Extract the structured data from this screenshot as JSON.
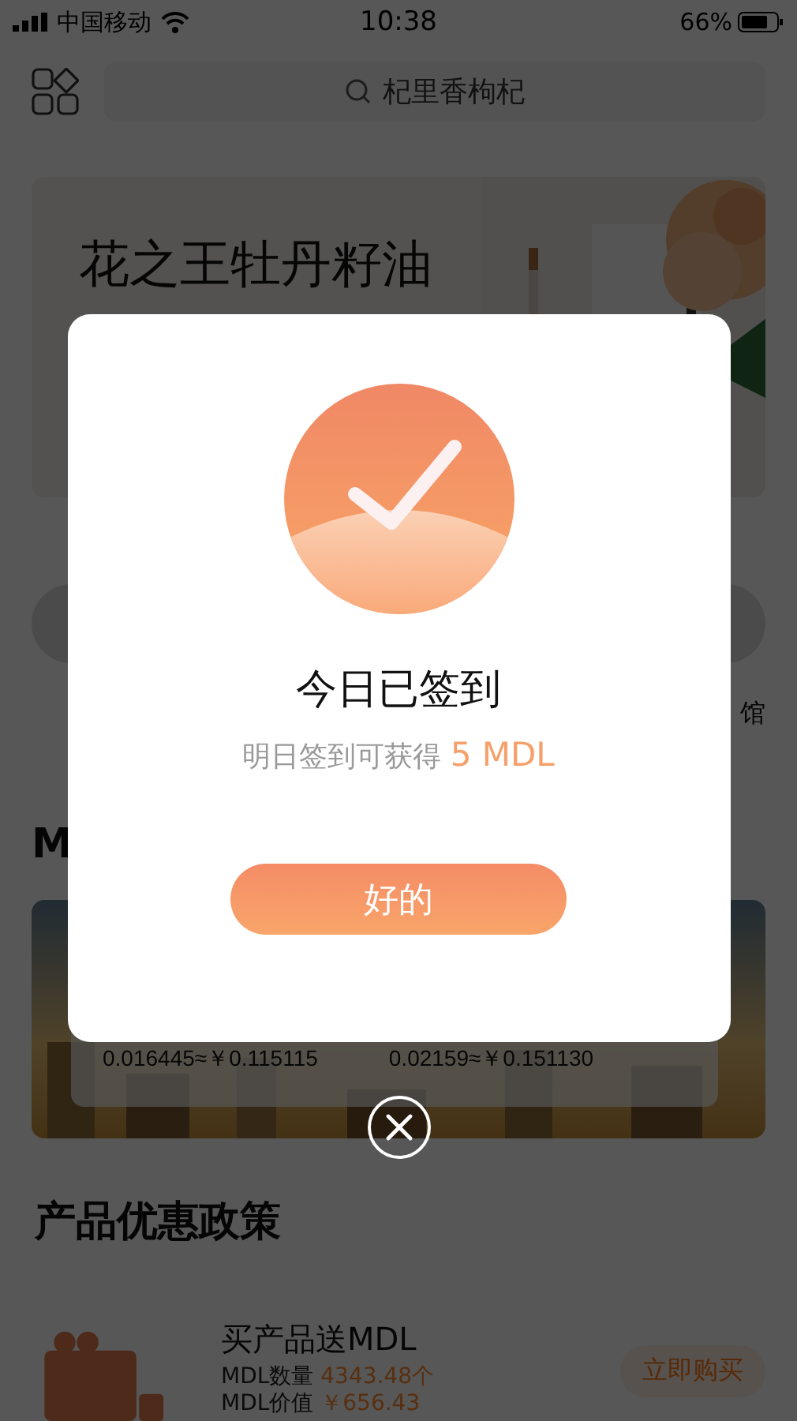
{
  "status_bar": {
    "carrier": "中国移动",
    "time": "10:38",
    "battery": "66%"
  },
  "header": {
    "search": {
      "placeholder": "杞里香枸杞"
    }
  },
  "banner": {
    "title": "花之王牡丹籽油"
  },
  "shortcut_label": "馆",
  "mdl_section": {
    "title": "M",
    "rates": [
      "0.016445≈￥0.115115",
      "0.02159≈￥0.151130"
    ]
  },
  "promo_section": {
    "title": "产品优惠政策",
    "offer": {
      "title": "买产品送MDL",
      "lines": [
        {
          "label": "MDL数量",
          "value": "4343.48个"
        },
        {
          "label": "MDL价值",
          "value": "￥656.43"
        }
      ],
      "button": "立即购买"
    }
  },
  "dialog": {
    "checked": true,
    "title": "今日已签到",
    "subtitle": "明日签到可获得",
    "reward": "5 MDL",
    "button": "好的"
  }
}
